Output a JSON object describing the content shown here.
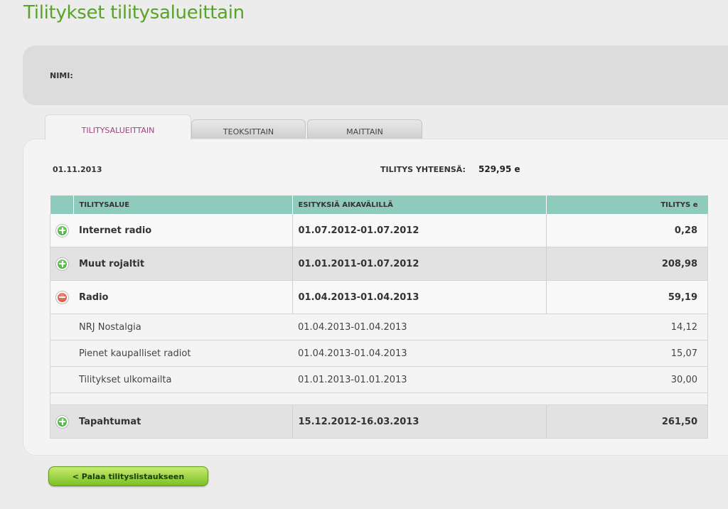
{
  "page": {
    "title": "Tilitykset tilitysalueittain"
  },
  "name_panel": {
    "label": "NIMI:"
  },
  "tabs": [
    {
      "label": "TILITYSALUEITTAIN",
      "active": true
    },
    {
      "label": "TEOKSITTAIN",
      "active": false
    },
    {
      "label": "MAITTAIN",
      "active": false
    }
  ],
  "summary": {
    "date": "01.11.2013",
    "total_label": "TILITYS YHTEENSÄ:",
    "total_value": "529,95 e"
  },
  "table": {
    "headers": [
      "TILITYSALUE",
      "ESITYKSIÄ AIKAVÄLILLÄ",
      "TILITYS e"
    ],
    "rows": [
      {
        "name": "Internet radio",
        "period": "01.07.2012-01.07.2012",
        "amount": "0,28",
        "icon": "plus-circle-icon"
      },
      {
        "name": "Muut rojaltit",
        "period": "01.01.2011-01.07.2012",
        "amount": "208,98",
        "icon": "plus-circle-icon"
      },
      {
        "name": "Radio",
        "period": "01.04.2013-01.04.2013",
        "amount": "59,19",
        "icon": "minus-circle-icon",
        "children": [
          {
            "name": "NRJ Nostalgia",
            "period": "01.04.2013-01.04.2013",
            "amount": "14,12"
          },
          {
            "name": "Pienet kaupalliset radiot",
            "period": "01.04.2013-01.04.2013",
            "amount": "15,07"
          },
          {
            "name": "Tilitykset ulkomailta",
            "period": "01.01.2013-01.01.2013",
            "amount": "30,00"
          }
        ]
      },
      {
        "name": "Tapahtumat",
        "period": "15.12.2012-16.03.2013",
        "amount": "261,50",
        "icon": "plus-circle-icon"
      }
    ]
  },
  "back_button": {
    "label": "< Palaa tilityslistaukseen"
  },
  "colors": {
    "title_green": "#5aa32a",
    "header_teal": "#8fcbbd",
    "active_tab_text": "#a4407c",
    "button_green": "#7cbf25"
  }
}
